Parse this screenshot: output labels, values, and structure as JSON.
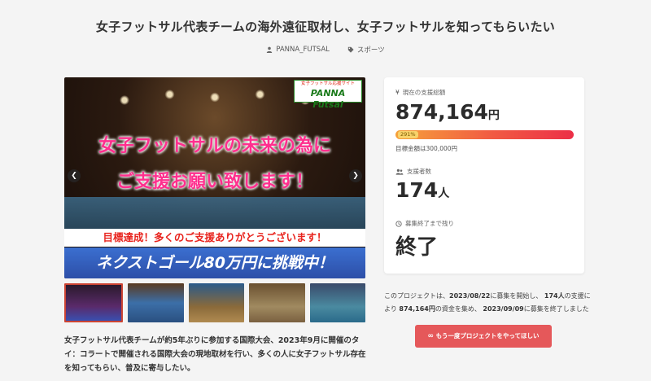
{
  "page": {
    "title": "女子フットサル代表チームの海外遠征取材し、女子フットサルを知ってもらいたい",
    "author": "PANNA_FUTSAL",
    "category": "スポーツ"
  },
  "hero": {
    "logo_small": "女子フットサル応援サイト",
    "logo_big": "PANNA Futsal",
    "headline_1": "女子フットサルの未来の為に",
    "headline_2": "ご支援お願い致します！",
    "band_1": "目標達成！多くのご支援ありがとうございます！",
    "band_2": "ネクストゴール80万円に挑戦中！"
  },
  "description": "女子フットサル代表チームが約5年ぶりに参加する国際大会、2023年9月に開催のタイ：コラートで開催される国際大会の現地取材を行い、多くの人に女子フットサル存在を知ってもらい、普及に寄与したい。",
  "stats": {
    "total_label": "現在の支援総額",
    "total_value": "874,164",
    "total_unit": "円",
    "progress_text": "291%",
    "progress_percent": 291,
    "goal_text": "目標金額は300,000円",
    "supporters_label": "支援者数",
    "supporters_value": "174",
    "supporters_unit": "人",
    "remaining_label": "募集終了まで残り",
    "remaining_value": "終了"
  },
  "summary": {
    "p1": "このプロジェクトは、",
    "start_date": "2023/08/22",
    "p2": "に募集を開始し、",
    "count": "174人",
    "p3": "の支援により",
    "amount": "874,164円",
    "p4": "の資金を集め、",
    "end_date": "2023/09/09",
    "p5": "に募集を終了しました"
  },
  "cta_label": "もう一度プロジェクトをやってほしい",
  "colors": {
    "accent": "#e5585a",
    "headline_pink": "#ff2f8e",
    "band_blue": "#2d4fa8"
  }
}
